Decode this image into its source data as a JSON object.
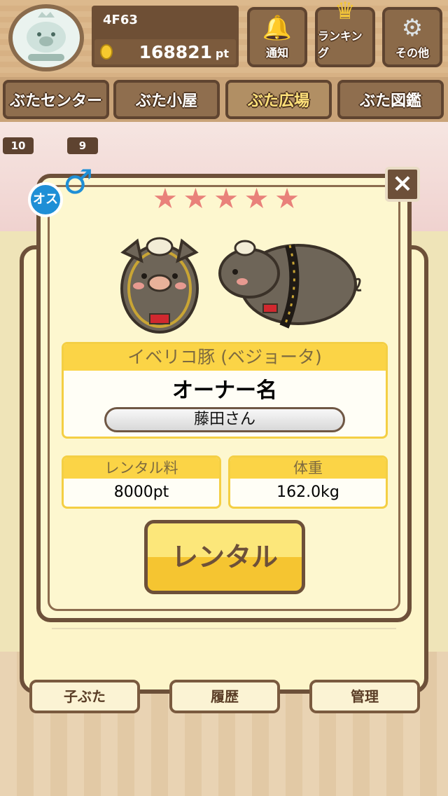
{
  "header": {
    "user_id": "4F63",
    "points": "168821",
    "points_unit": "pt",
    "buttons": [
      {
        "label": "通知",
        "icon": "bell-icon"
      },
      {
        "label": "ランキング",
        "icon": "crown-icon"
      },
      {
        "label": "その他",
        "icon": "gear-icon"
      }
    ]
  },
  "nav": {
    "tabs": [
      "ぶたセンター",
      "ぶた小屋",
      "ぶた広場",
      "ぶた図鑑"
    ],
    "active_index": 2
  },
  "background": {
    "badges": [
      "10",
      "9"
    ],
    "bottom_buttons": [
      "子ぶた",
      "履歴",
      "管理"
    ]
  },
  "modal": {
    "gender_label": "オス",
    "rating": 5,
    "pig_name": "イベリコ豚 (ベジョータ)",
    "owner_title": "オーナー名",
    "owner_name": "藤田さん",
    "rental_fee_label": "レンタル料",
    "rental_fee_value": "8000pt",
    "weight_label": "体重",
    "weight_value": "162.0kg",
    "rental_button": "レンタル",
    "close_label": "×"
  },
  "colors": {
    "accent_yellow": "#fbd446",
    "wood_dark": "#6d5039",
    "star_pink": "#e9817a",
    "male_blue": "#1f8fd6"
  }
}
